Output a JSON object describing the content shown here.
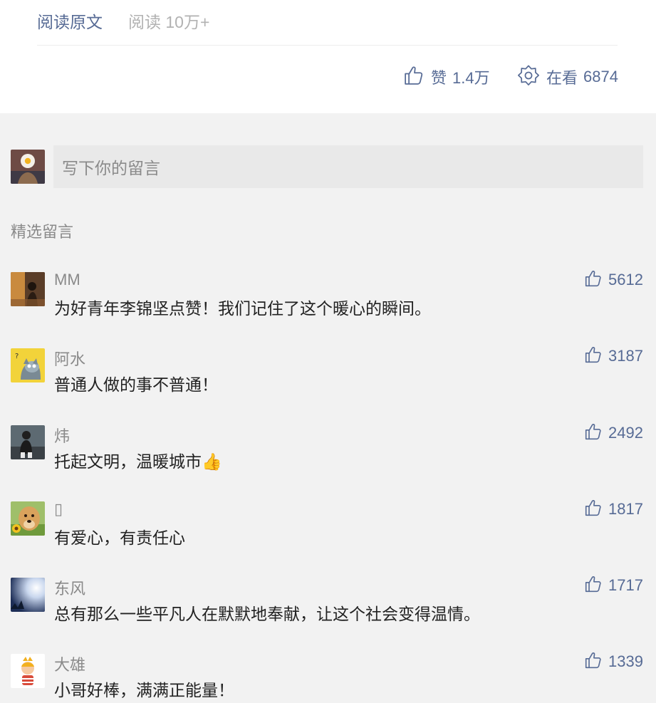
{
  "article": {
    "read_original": "阅读原文",
    "read_count": "阅读 10万+",
    "like_label": "赞",
    "like_count": "1.4万",
    "watching_label": "在看",
    "watching_count": "6874"
  },
  "comment_input": {
    "placeholder": "写下你的留言"
  },
  "featured": {
    "title": "精选留言",
    "comments": [
      {
        "name": "MM",
        "text": "为好青年李锦坚点赞！我们记住了这个暖心的瞬间。",
        "likes": "5612"
      },
      {
        "name": "阿水",
        "text": "普通人做的事不普通！",
        "likes": "3187"
      },
      {
        "name": "炜",
        "text": "托起文明，温暖城市",
        "emoji": "👍",
        "likes": "2492"
      },
      {
        "name": "▯",
        "text": "有爱心，有责任心",
        "likes": "1817"
      },
      {
        "name": "东风",
        "text": "总有那么一些平凡人在默默地奉献，让这个社会变得温情。",
        "likes": "1717"
      },
      {
        "name": "大雄",
        "text": "小哥好棒，满满正能量！",
        "likes": "1339"
      }
    ]
  },
  "colors": {
    "link": "#576b95",
    "muted": "#8a8a8a",
    "background": "#f2f2f2"
  },
  "icons": {
    "like": "thumbs-up-icon",
    "watching": "watching-flower-icon"
  }
}
